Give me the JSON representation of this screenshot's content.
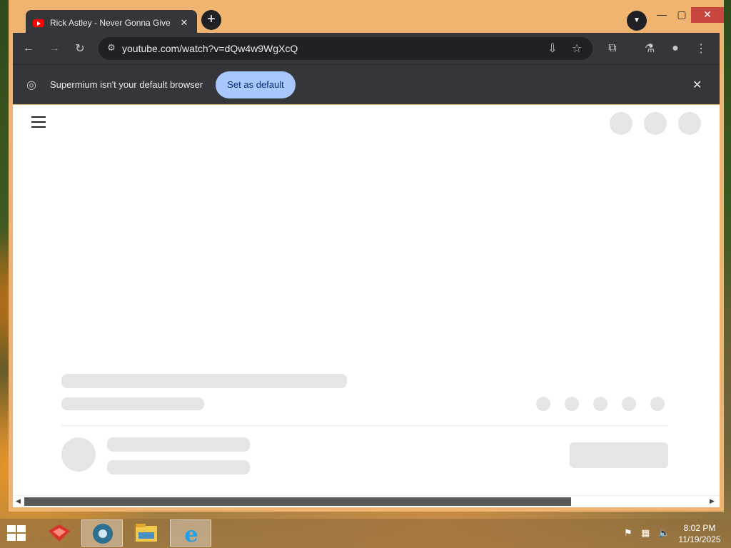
{
  "browser": {
    "tab": {
      "title": "Rick Astley - Never Gonna Give",
      "favicon": "youtube-icon"
    },
    "toolbar": {
      "url": "youtube.com/watch?v=dQw4w9WgXcQ"
    },
    "infobar": {
      "message": "Supermium isn't your default browser",
      "button_label": "Set as default"
    }
  },
  "taskbar": {
    "apps": [
      "start-icon",
      "red-app-icon",
      "browser-icon",
      "file-explorer-icon",
      "internet-explorer-icon"
    ],
    "clock": {
      "time": "8:02 PM",
      "date": "11/19/2025"
    }
  },
  "colors": {
    "frame": "#f0b470",
    "toolbar": "#35363a",
    "accent_button": "#a8c7fa",
    "close_button": "#c7463d"
  }
}
